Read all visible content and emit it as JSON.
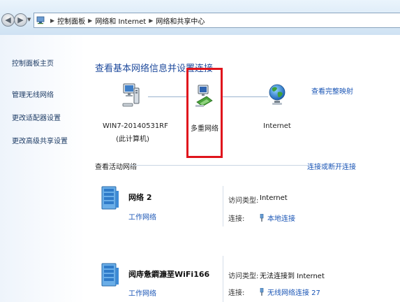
{
  "address": {
    "crumbs": [
      "控制面板",
      "网络和 Internet",
      "网络和共享中心"
    ]
  },
  "sidebar": {
    "items": [
      {
        "label": "控制面板主页"
      },
      {
        "label": "管理无线网络"
      },
      {
        "label": "更改适配器设置"
      },
      {
        "label": "更改高级共享设置"
      }
    ]
  },
  "main": {
    "title": "查看基本网络信息并设置连接",
    "map_link": "查看完整映射",
    "map": {
      "computer_name": "WIN7-20140531RF",
      "computer_sub": "(此计算机)",
      "network_label": "多重网络",
      "internet_label": "Internet"
    },
    "active_section": {
      "label": "查看活动网络",
      "link": "连接或断开连接"
    },
    "networks": [
      {
        "name": "网络  2",
        "type": "工作网络",
        "access_label": "访问类型:",
        "access_value": "Internet",
        "conn_label": "连接:",
        "conn_value": "本地连接"
      },
      {
        "name": "阋庤惫鐧濂垩WiFi166",
        "type": "工作网络",
        "access_label": "访问类型:",
        "access_value": "无法连接到 Internet",
        "conn_label": "连接:",
        "conn_value": "无线网络连接 27"
      }
    ]
  },
  "colors": {
    "link": "#1a55b5",
    "title": "#1e4a9c",
    "highlight": "#e0141c"
  }
}
